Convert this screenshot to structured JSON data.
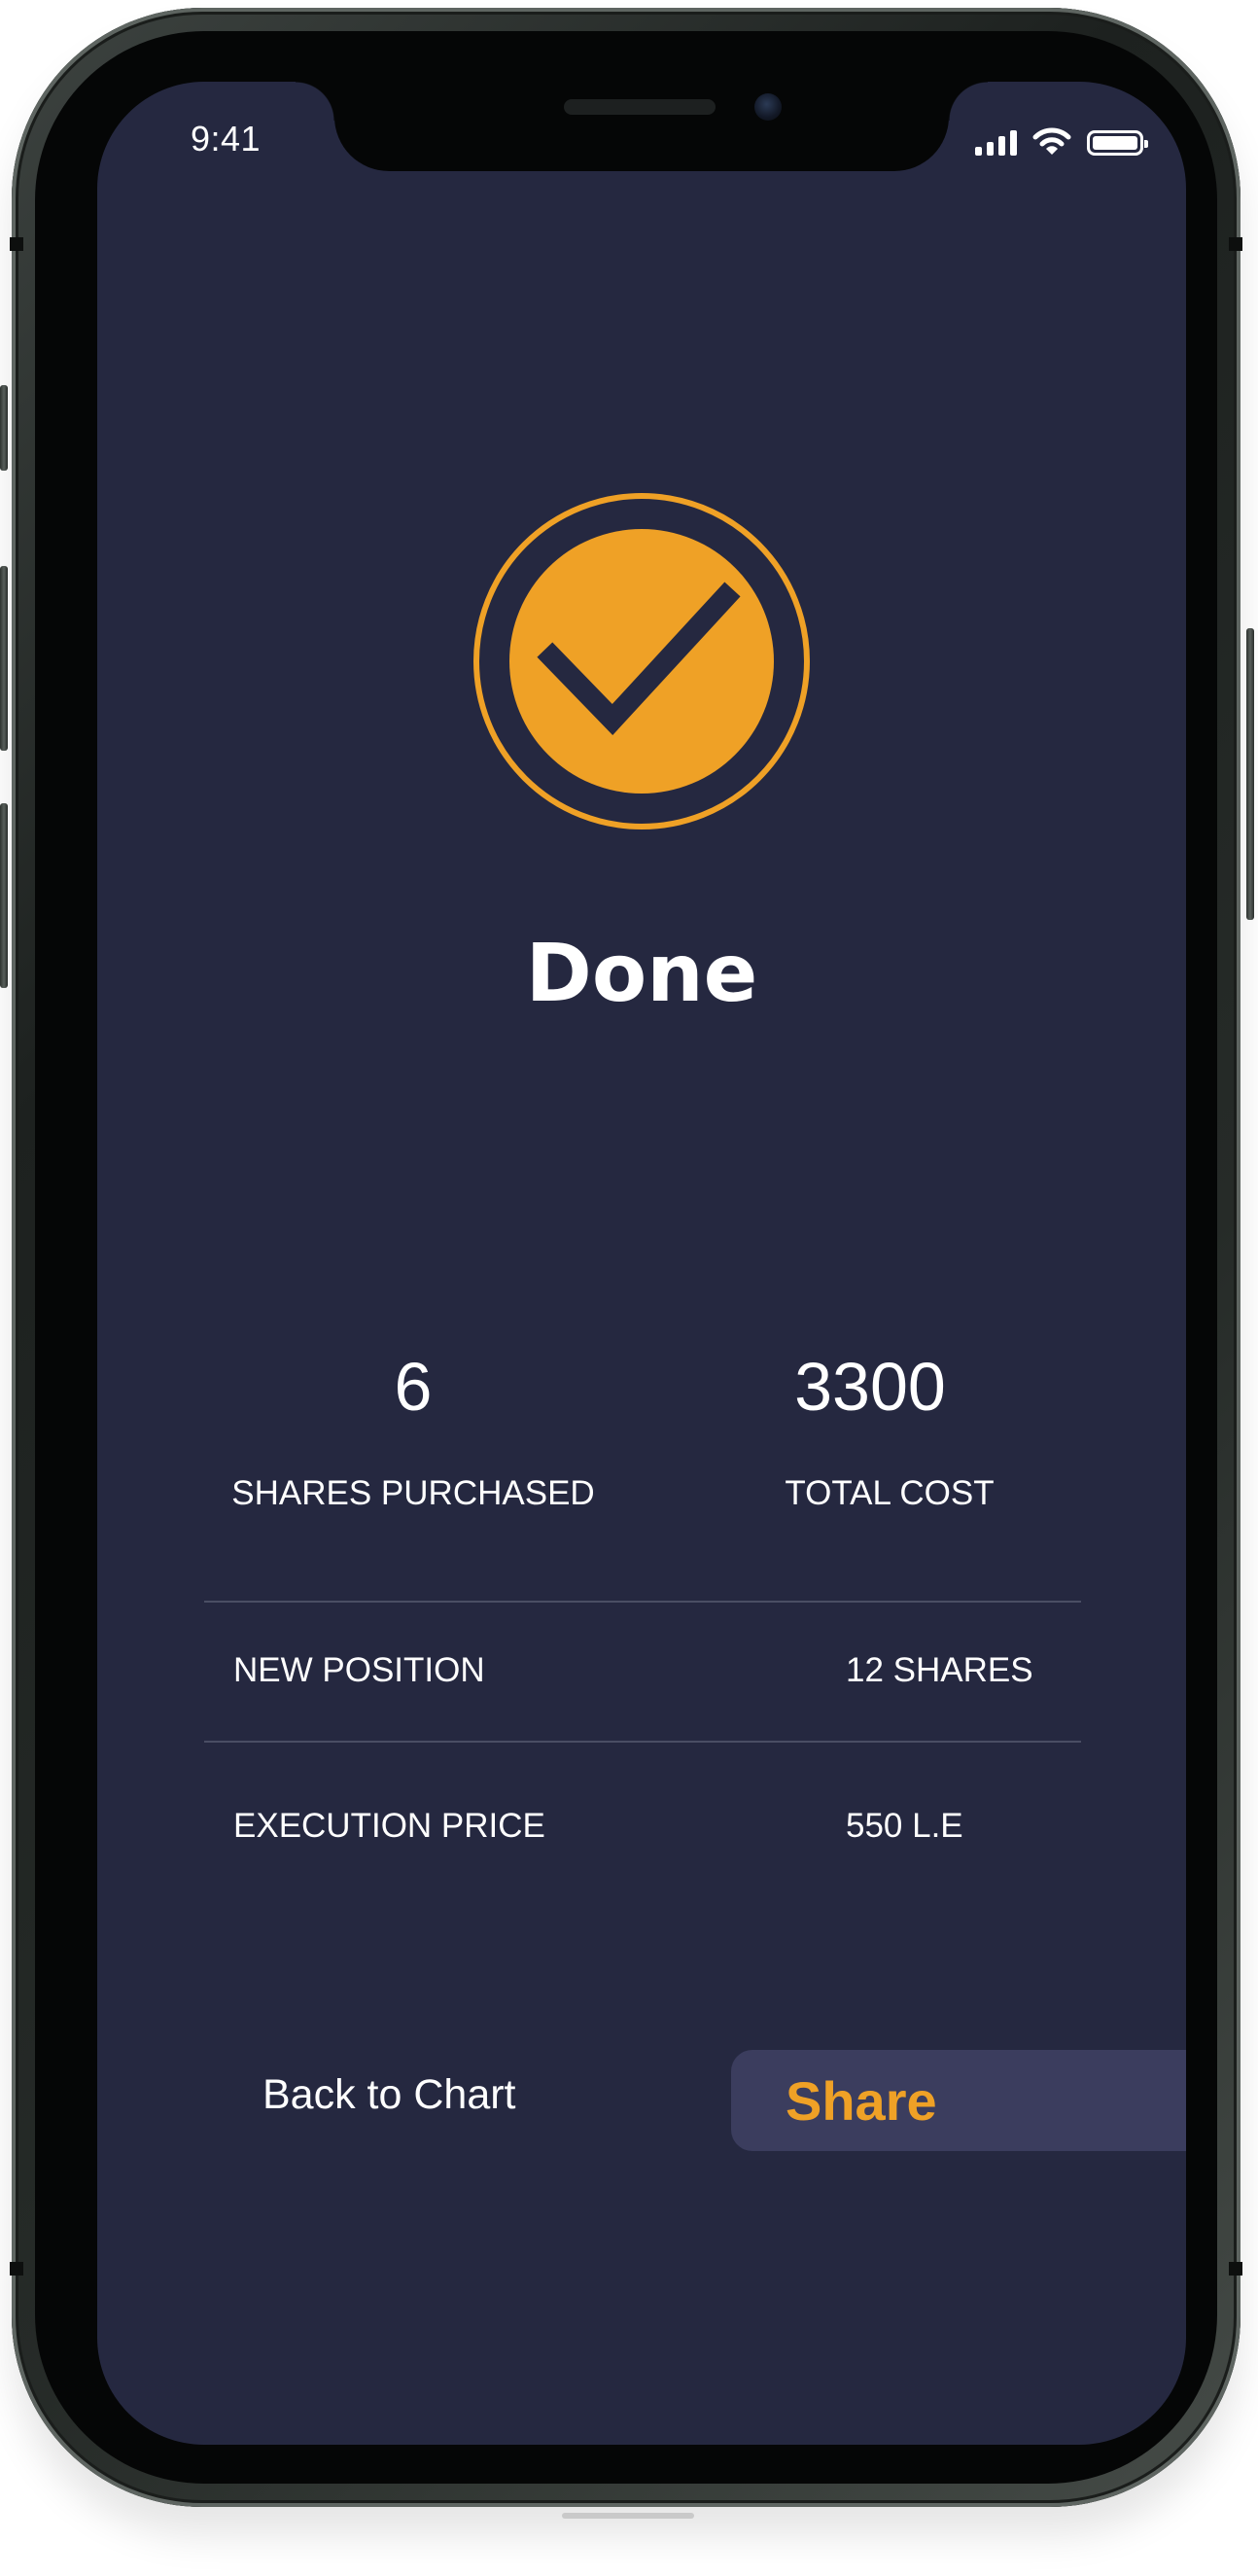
{
  "status_bar": {
    "time": "9:41",
    "icons": [
      "cellular-signal-icon",
      "wifi-icon",
      "battery-icon"
    ]
  },
  "confirmation": {
    "icon": "check-circle-icon",
    "title": "Done"
  },
  "summary": {
    "shares_purchased_value": "6",
    "shares_purchased_label": "SHARES PURCHASED",
    "total_cost_value": "3300",
    "total_cost_label": "TOTAL COST"
  },
  "details": [
    {
      "label": "NEW POSITION",
      "value": "12 SHARES"
    },
    {
      "label": "EXECUTION PRICE",
      "value": "550 L.E"
    }
  ],
  "actions": {
    "back_label": "Back to Chart",
    "share_label": "Share"
  },
  "colors": {
    "screen_background": "#252840",
    "accent": "#efa126",
    "button_background": "#3b3d5e",
    "text": "#ffffff",
    "divider": "#4a4e64"
  }
}
